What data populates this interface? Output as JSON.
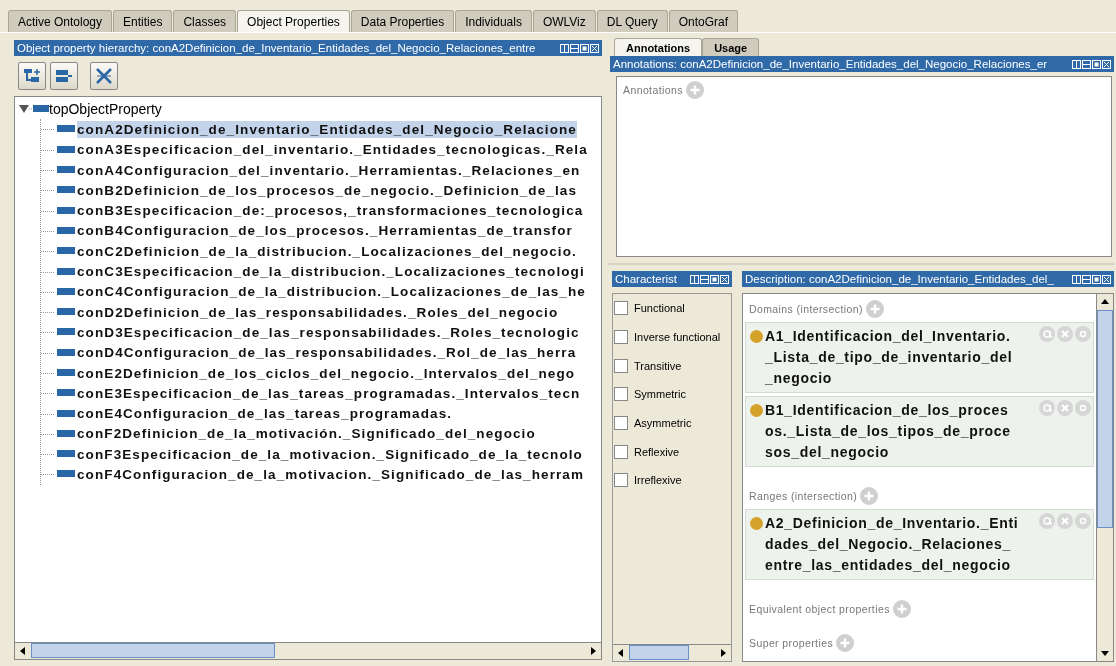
{
  "main_tabs": [
    {
      "label": "Active Ontology",
      "selected": false
    },
    {
      "label": "Entities",
      "selected": false
    },
    {
      "label": "Classes",
      "selected": false
    },
    {
      "label": "Object Properties",
      "selected": true
    },
    {
      "label": "Data Properties",
      "selected": false
    },
    {
      "label": "Individuals",
      "selected": false
    },
    {
      "label": "OWLViz",
      "selected": false
    },
    {
      "label": "DL Query",
      "selected": false
    },
    {
      "label": "OntoGraf",
      "selected": false
    }
  ],
  "hierarchy_panel": {
    "title": "Object property hierarchy: conA2Definicion_de_Inventario_Entidades_del_Negocio_Relaciones_entre",
    "toolbar": [
      {
        "kind": "add-sub"
      },
      {
        "kind": "add-sibling"
      },
      {
        "kind": "delete"
      }
    ],
    "tree": {
      "label": "topObjectProperty",
      "expanded": true,
      "children": [
        {
          "label": "conA2Definicion_de_Inventario_Entidades_del_Negocio_Relacione",
          "selected": true
        },
        {
          "label": "conA3Especificacion_del_inventario._Entidades_tecnologicas._Rela",
          "selected": false
        },
        {
          "label": "conA4Configuracion_del_inventario._Herramientas._Relaciones_en",
          "selected": false
        },
        {
          "label": "conB2Definicion_de_los_procesos_de_negocio._Definicion_de_las",
          "selected": false
        },
        {
          "label": "conB3Especificacion_de:_procesos,_transformaciones_tecnologica",
          "selected": false
        },
        {
          "label": "conB4Configuracion_de_los_procesos._Herramientas_de_transfor",
          "selected": false
        },
        {
          "label": "conC2Definicion_de_la_distribucion._Localizaciones_del_negocio.",
          "selected": false
        },
        {
          "label": "conC3Especificacion_de_la_distribucion._Localizaciones_tecnologi",
          "selected": false
        },
        {
          "label": "conC4Configuracion_de_la_distribucion._Localizaciones_de_las_he",
          "selected": false
        },
        {
          "label": "conD2Definicion_de_las_responsabilidades._Roles_del_negocio",
          "selected": false
        },
        {
          "label": "conD3Especificacion_de_las_responsabilidades._Roles_tecnologic",
          "selected": false
        },
        {
          "label": "conD4Configuracion_de_las_responsabilidades._Rol_de_las_herra",
          "selected": false
        },
        {
          "label": "conE2Definicion_de_los_ciclos_del_negocio._Intervalos_del_nego",
          "selected": false
        },
        {
          "label": "conE3Especificacion_de_las_tareas_programadas._Intervalos_tecn",
          "selected": false
        },
        {
          "label": "conE4Configuracion_de_las_tareas_programadas.",
          "selected": false
        },
        {
          "label": "conF2Definicion_de_la_motivación._Significado_del_negocio",
          "selected": false
        },
        {
          "label": "conF3Especificacion_de_la_motivacion._Significado_de_la_tecnolo",
          "selected": false
        },
        {
          "label": "conF4Configuracion_de_la_motivacion._Significado_de_las_herram",
          "selected": false
        }
      ]
    }
  },
  "annotations_panel": {
    "tabs": [
      {
        "label": "Annotations",
        "selected": true
      },
      {
        "label": "Usage",
        "selected": false
      }
    ],
    "title": "Annotations: conA2Definicion_de_Inventario_Entidades_del_Negocio_Relaciones_er",
    "section": "Annotations"
  },
  "characteristics_panel": {
    "title": "Characterist",
    "items": [
      {
        "label": "Functional",
        "checked": false
      },
      {
        "label": "Inverse functional",
        "checked": false
      },
      {
        "label": "Transitive",
        "checked": false
      },
      {
        "label": "Symmetric",
        "checked": false
      },
      {
        "label": "Asymmetric",
        "checked": false
      },
      {
        "label": "Reflexive",
        "checked": false
      },
      {
        "label": "Irreflexive",
        "checked": false
      }
    ]
  },
  "description_panel": {
    "title": "Description: conA2Definicion_de_Inventario_Entidades_del_",
    "sections": [
      {
        "header": "Domains (intersection)",
        "entries": [
          {
            "lines": [
              "A1_Identificacion_del_Inventario.",
              "_Lista_de_tipo_de_inventario_del",
              "_negocio"
            ],
            "color": "#d4a12a"
          },
          {
            "lines": [
              "B1_Identificacion_de_los_proces",
              "os._Lista_de_los_tipos_de_proce",
              "sos_del_negocio"
            ],
            "color": "#d4a12a"
          }
        ]
      },
      {
        "header": "Ranges (intersection)",
        "entries": [
          {
            "lines": [
              "A2_Definicion_de_Inventario._Enti",
              "dades_del_Negocio._Relaciones_",
              "entre_las_entidades_del_negocio"
            ],
            "color": "#d4a12a"
          }
        ]
      },
      {
        "header": "Equivalent object properties"
      },
      {
        "header": "Super properties"
      }
    ]
  }
}
